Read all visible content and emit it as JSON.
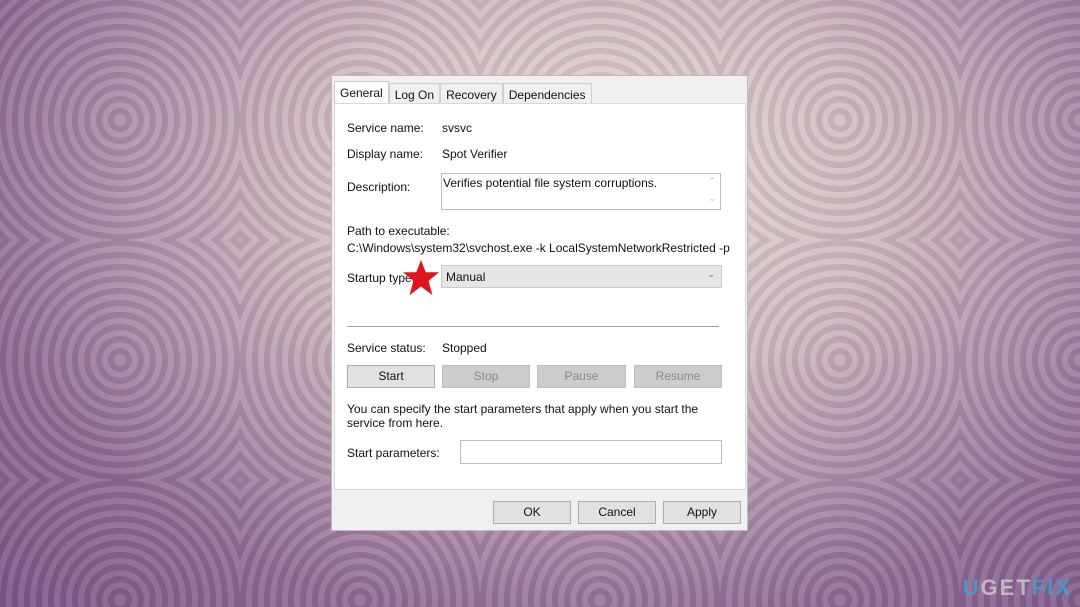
{
  "tabs": [
    "General",
    "Log On",
    "Recovery",
    "Dependencies"
  ],
  "fields": {
    "service_name_label": "Service name:",
    "service_name": "svsvc",
    "display_name_label": "Display name:",
    "display_name": "Spot Verifier",
    "description_label": "Description:",
    "description": "Verifies potential file system corruptions.",
    "path_label": "Path to executable:",
    "path": "C:\\Windows\\system32\\svchost.exe -k LocalSystemNetworkRestricted -p",
    "startup_type_label": "Startup type:",
    "startup_type": "Manual",
    "service_status_label": "Service status:",
    "service_status": "Stopped"
  },
  "service_buttons": {
    "start": "Start",
    "stop": "Stop",
    "pause": "Pause",
    "resume": "Resume"
  },
  "help_text": "You can specify the start parameters that apply when you start the service from here.",
  "start_params_label": "Start parameters:",
  "start_params_value": "",
  "footer": {
    "ok": "OK",
    "cancel": "Cancel",
    "apply": "Apply"
  },
  "annotation_color": "#e0141e",
  "watermark": "UGETFIX"
}
